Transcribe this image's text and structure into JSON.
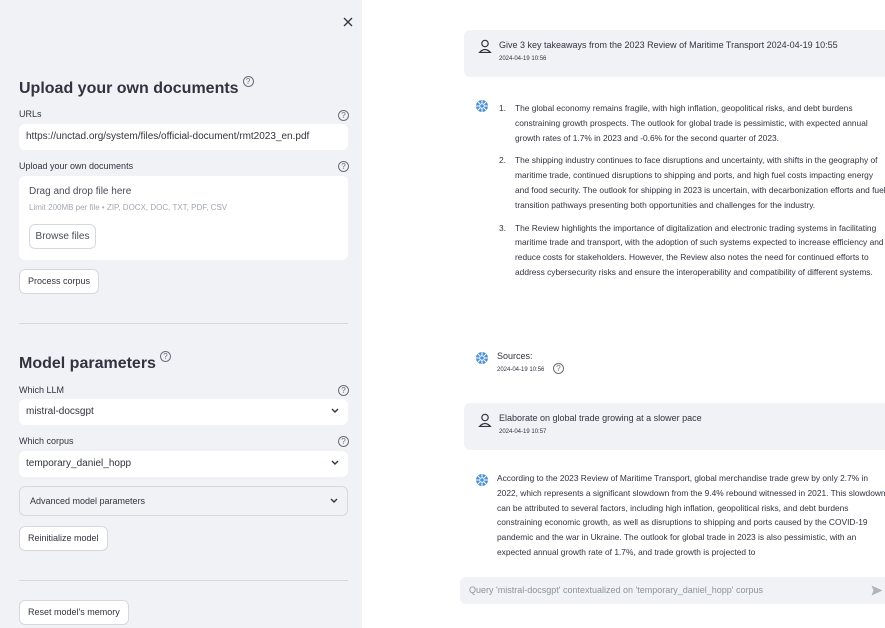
{
  "sidebar": {
    "close_icon": "close-icon",
    "upload_section_title": "Upload your own documents",
    "urls_label": "URLs",
    "urls_value": "https://unctad.org/system/files/official-document/rmt2023_en.pdf",
    "upload_label": "Upload your own documents",
    "dropzone_title": "Drag and drop file here",
    "dropzone_limit": "Limit 200MB per file • ZIP, DOCX, DOC, TXT, PDF, CSV",
    "browse_label": "Browse files",
    "process_label": "Process corpus",
    "model_section_title": "Model parameters",
    "llm_label": "Which LLM",
    "llm_value": "mistral-docsgpt",
    "corpus_label": "Which corpus",
    "corpus_value": "temporary_daniel_hopp",
    "advanced_label": "Advanced model parameters",
    "reinit_label": "Reinitialize model",
    "reset_label": "Reset model's memory"
  },
  "chat": {
    "messages": [
      {
        "role": "user",
        "text": "Give 3 key takeaways from the 2023 Review of Maritime Transport 2024-04-19 10:55",
        "time": "2024-04-19 10:56"
      },
      {
        "role": "assistant",
        "items": [
          {
            "num": "1.",
            "text": "The global economy remains fragile, with high inflation, geopolitical risks, and debt burdens constraining growth prospects. The outlook for global trade is pessimistic, with expected annual growth rates of 1.7% in 2023 and -0.6% for the second quarter of 2023."
          },
          {
            "num": "2.",
            "text": "The shipping industry continues to face disruptions and uncertainty, with shifts in the geography of maritime trade, continued disruptions to shipping and ports, and high fuel costs impacting energy and food security. The outlook for shipping in 2023 is uncertain, with decarbonization efforts and fuel transition pathways presenting both opportunities and challenges for the industry."
          },
          {
            "num": "3.",
            "text": "The Review highlights the importance of digitalization and electronic trading systems in facilitating maritime trade and transport, with the adoption of such systems expected to increase efficiency and reduce costs for stakeholders. However, the Review also notes the need for continued efforts to address cybersecurity risks and ensure the interoperability and compatibility of different systems."
          }
        ]
      },
      {
        "role": "sources",
        "label": "Sources:",
        "time": "2024-04-19 10:56"
      },
      {
        "role": "user",
        "text": "Elaborate on global trade growing at a slower pace",
        "time": "2024-04-19 10:57"
      },
      {
        "role": "assistant",
        "text": "According to the 2023 Review of Maritime Transport, global merchandise trade grew by only 2.7% in 2022, which represents a significant slowdown from the 9.4% rebound witnessed in 2021. This slowdown can be attributed to several factors, including high inflation, geopolitical risks, and debt burdens constraining economic growth, as well as disruptions to shipping and ports caused by the COVID-19 pandemic and the war in Ukraine. The outlook for global trade in 2023 is also pessimistic, with an expected annual growth rate of 1.7%, and trade growth is projected to"
      }
    ],
    "input_placeholder": "Query 'mistral-docsgpt' contextualized on 'temporary_daniel_hopp' corpus",
    "send_icon": "send-icon"
  },
  "colors": {
    "sidebar_bg": "#f0f2f6",
    "text": "#31333f",
    "bot_icon": "#4a90d9"
  }
}
